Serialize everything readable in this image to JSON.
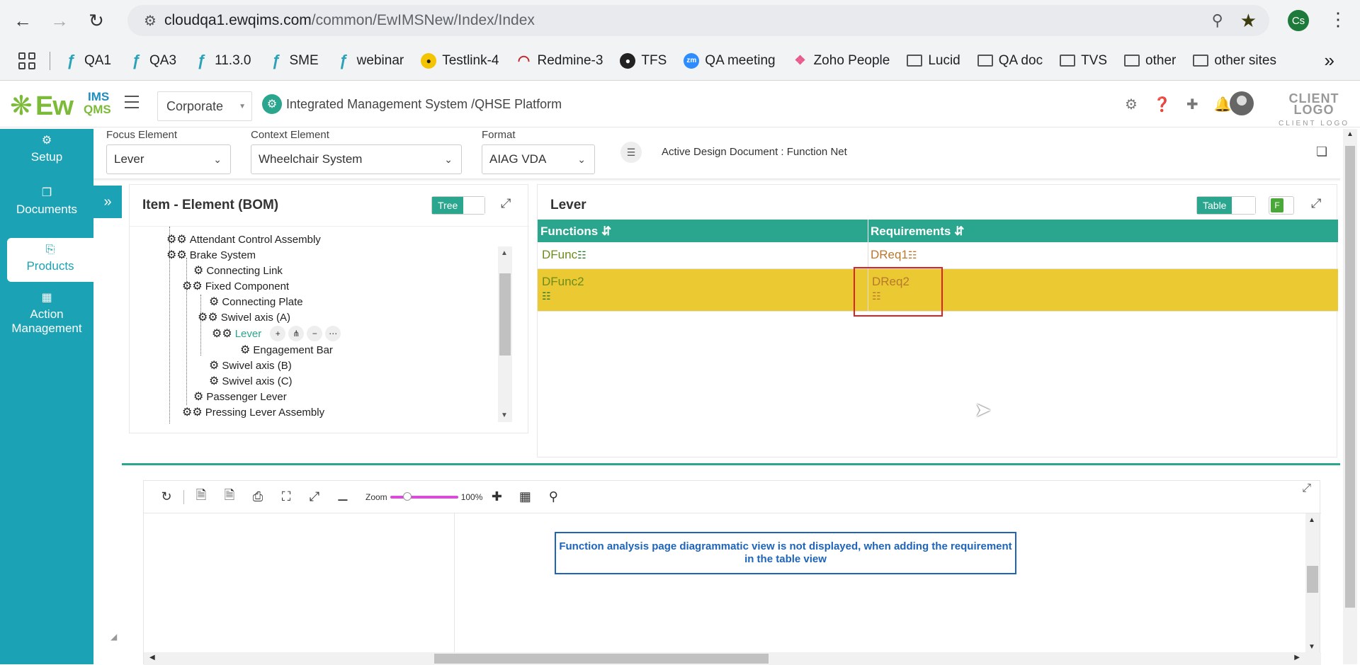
{
  "browser": {
    "url_host": "cloudqa1.ewqims.com",
    "url_path": "/common/EwIMSNew/Index/Index",
    "profile_initials": "Cs",
    "bookmarks": [
      {
        "label": "QA1",
        "icon": "ewqims-icon"
      },
      {
        "label": "QA3",
        "icon": "ewqims-icon"
      },
      {
        "label": "11.3.0",
        "icon": "ewqims-icon"
      },
      {
        "label": "SME",
        "icon": "ewqims-icon"
      },
      {
        "label": "webinar",
        "icon": "ewqims-icon"
      },
      {
        "label": "Testlink-4",
        "icon": "testlink-icon"
      },
      {
        "label": "Redmine-3",
        "icon": "redmine-icon"
      },
      {
        "label": "TFS",
        "icon": "tfs-icon"
      },
      {
        "label": "QA meeting",
        "icon": "zoom-icon"
      },
      {
        "label": "Zoho People",
        "icon": "zoho-icon"
      },
      {
        "label": "Lucid",
        "icon": "folder-icon"
      },
      {
        "label": "QA doc",
        "icon": "folder-icon"
      },
      {
        "label": "TVS",
        "icon": "folder-icon"
      },
      {
        "label": "other",
        "icon": "folder-icon"
      },
      {
        "label": "other sites",
        "icon": "folder-icon"
      }
    ],
    "more_label": "»"
  },
  "header": {
    "logo_ew": "Ew",
    "logo_ims": "IMS",
    "logo_qms": "QMS",
    "org_select": "Corporate",
    "platform_title": "Integrated Management System /QHSE Platform",
    "client_logo": "CLIENT LOGO",
    "client_logo_sub": "CLIENT LOGO"
  },
  "sidebar": {
    "items": [
      {
        "label": "Setup",
        "icon": "gear-icon"
      },
      {
        "label": "Documents",
        "icon": "document-icon"
      },
      {
        "label": "Products",
        "icon": "product-icon",
        "active": true
      },
      {
        "label": "Action Management",
        "icon": "building-icon"
      }
    ]
  },
  "filters": {
    "focus_label": "Focus Element",
    "focus_value": "Lever",
    "context_label": "Context Element",
    "context_value": "Wheelchair System",
    "format_label": "Format",
    "format_value": "AIAG VDA",
    "active_doc": "Active Design Document : Function Net"
  },
  "tree_panel": {
    "title": "Item - Element (BOM)",
    "toggle_label": "Tree",
    "nodes": [
      {
        "label": "Attendant Control Assembly"
      },
      {
        "label": "Brake System"
      },
      {
        "label": "Connecting Link"
      },
      {
        "label": "Fixed Component"
      },
      {
        "label": "Connecting Plate"
      },
      {
        "label": "Swivel axis (A)"
      },
      {
        "label": "Lever",
        "selected": true
      },
      {
        "label": "Engagement Bar"
      },
      {
        "label": "Swivel axis (B)"
      },
      {
        "label": "Swivel axis (C)"
      },
      {
        "label": "Passenger Lever"
      },
      {
        "label": "Pressing Lever Assembly"
      }
    ],
    "node_actions": [
      "+",
      "⋔",
      "−",
      "⋯"
    ]
  },
  "table_panel": {
    "title": "Lever",
    "toggle_label": "Table",
    "f_badge": "F",
    "columns": [
      "Functions",
      "Requirements"
    ],
    "rows": [
      {
        "function": "DFunc",
        "requirement": "DReq1",
        "highlighted": false
      },
      {
        "function": "DFunc2",
        "requirement": "DReq2",
        "highlighted": true
      }
    ],
    "highlight_color": "#eac933"
  },
  "diagram": {
    "zoom_label": "Zoom",
    "zoom_value": "100%",
    "note": "Function analysis page diagrammatic view is not displayed, when adding the requirement in the table view"
  },
  "colors": {
    "accent": "#1ba2b4",
    "green": "#2aa58e",
    "note_blue": "#1e64b8",
    "annotation_red": "#d22222"
  }
}
